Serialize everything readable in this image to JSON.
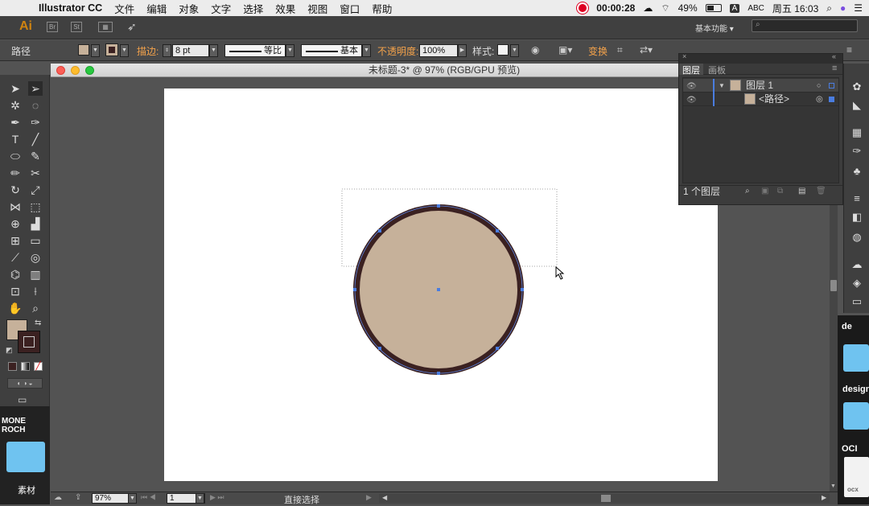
{
  "menubar": {
    "app_name": "Illustrator CC",
    "items": [
      "文件",
      "编辑",
      "对象",
      "文字",
      "选择",
      "效果",
      "视图",
      "窗口",
      "帮助"
    ],
    "timer": "00:00:28",
    "battery": "49%",
    "input_method": "ABC",
    "input_badge": "A",
    "datetime": "周五 16:03"
  },
  "appbar": {
    "logo": "Ai",
    "workspace_label": "基本功能",
    "workspace_arrow": "▾",
    "br_label": "Br",
    "st_label": "St"
  },
  "controlbar": {
    "selection_type": "路径",
    "stroke_label": "描边:",
    "stroke_weight": "8 pt",
    "profile_label": "等比",
    "brush_label": "基本",
    "opacity_label": "不透明度:",
    "opacity_value": "100%",
    "style_label": "样式:",
    "transform_label": "变换"
  },
  "document": {
    "title": "未标题-3* @ 97% (RGB/GPU 预览)",
    "zoom": "97%",
    "artboard_number": "1",
    "status_text": "直接选择"
  },
  "colors": {
    "fill": "#c6b19a",
    "stroke": "#3b2121",
    "anchor": "#4a7de0",
    "accent_orange": "#f5a34b"
  },
  "layers_panel": {
    "tab_layers": "图层",
    "tab_artboards": "画板",
    "layer_name": "图层 1",
    "sublayer_name": "<路径>",
    "footer_count": "1 个图层"
  },
  "desktop": {
    "left_label": "MONE ROCH",
    "folder_label": "素材",
    "right_label1": "de",
    "right_label2": "design",
    "right_label3": "OCI",
    "right_label4": "ocx"
  }
}
